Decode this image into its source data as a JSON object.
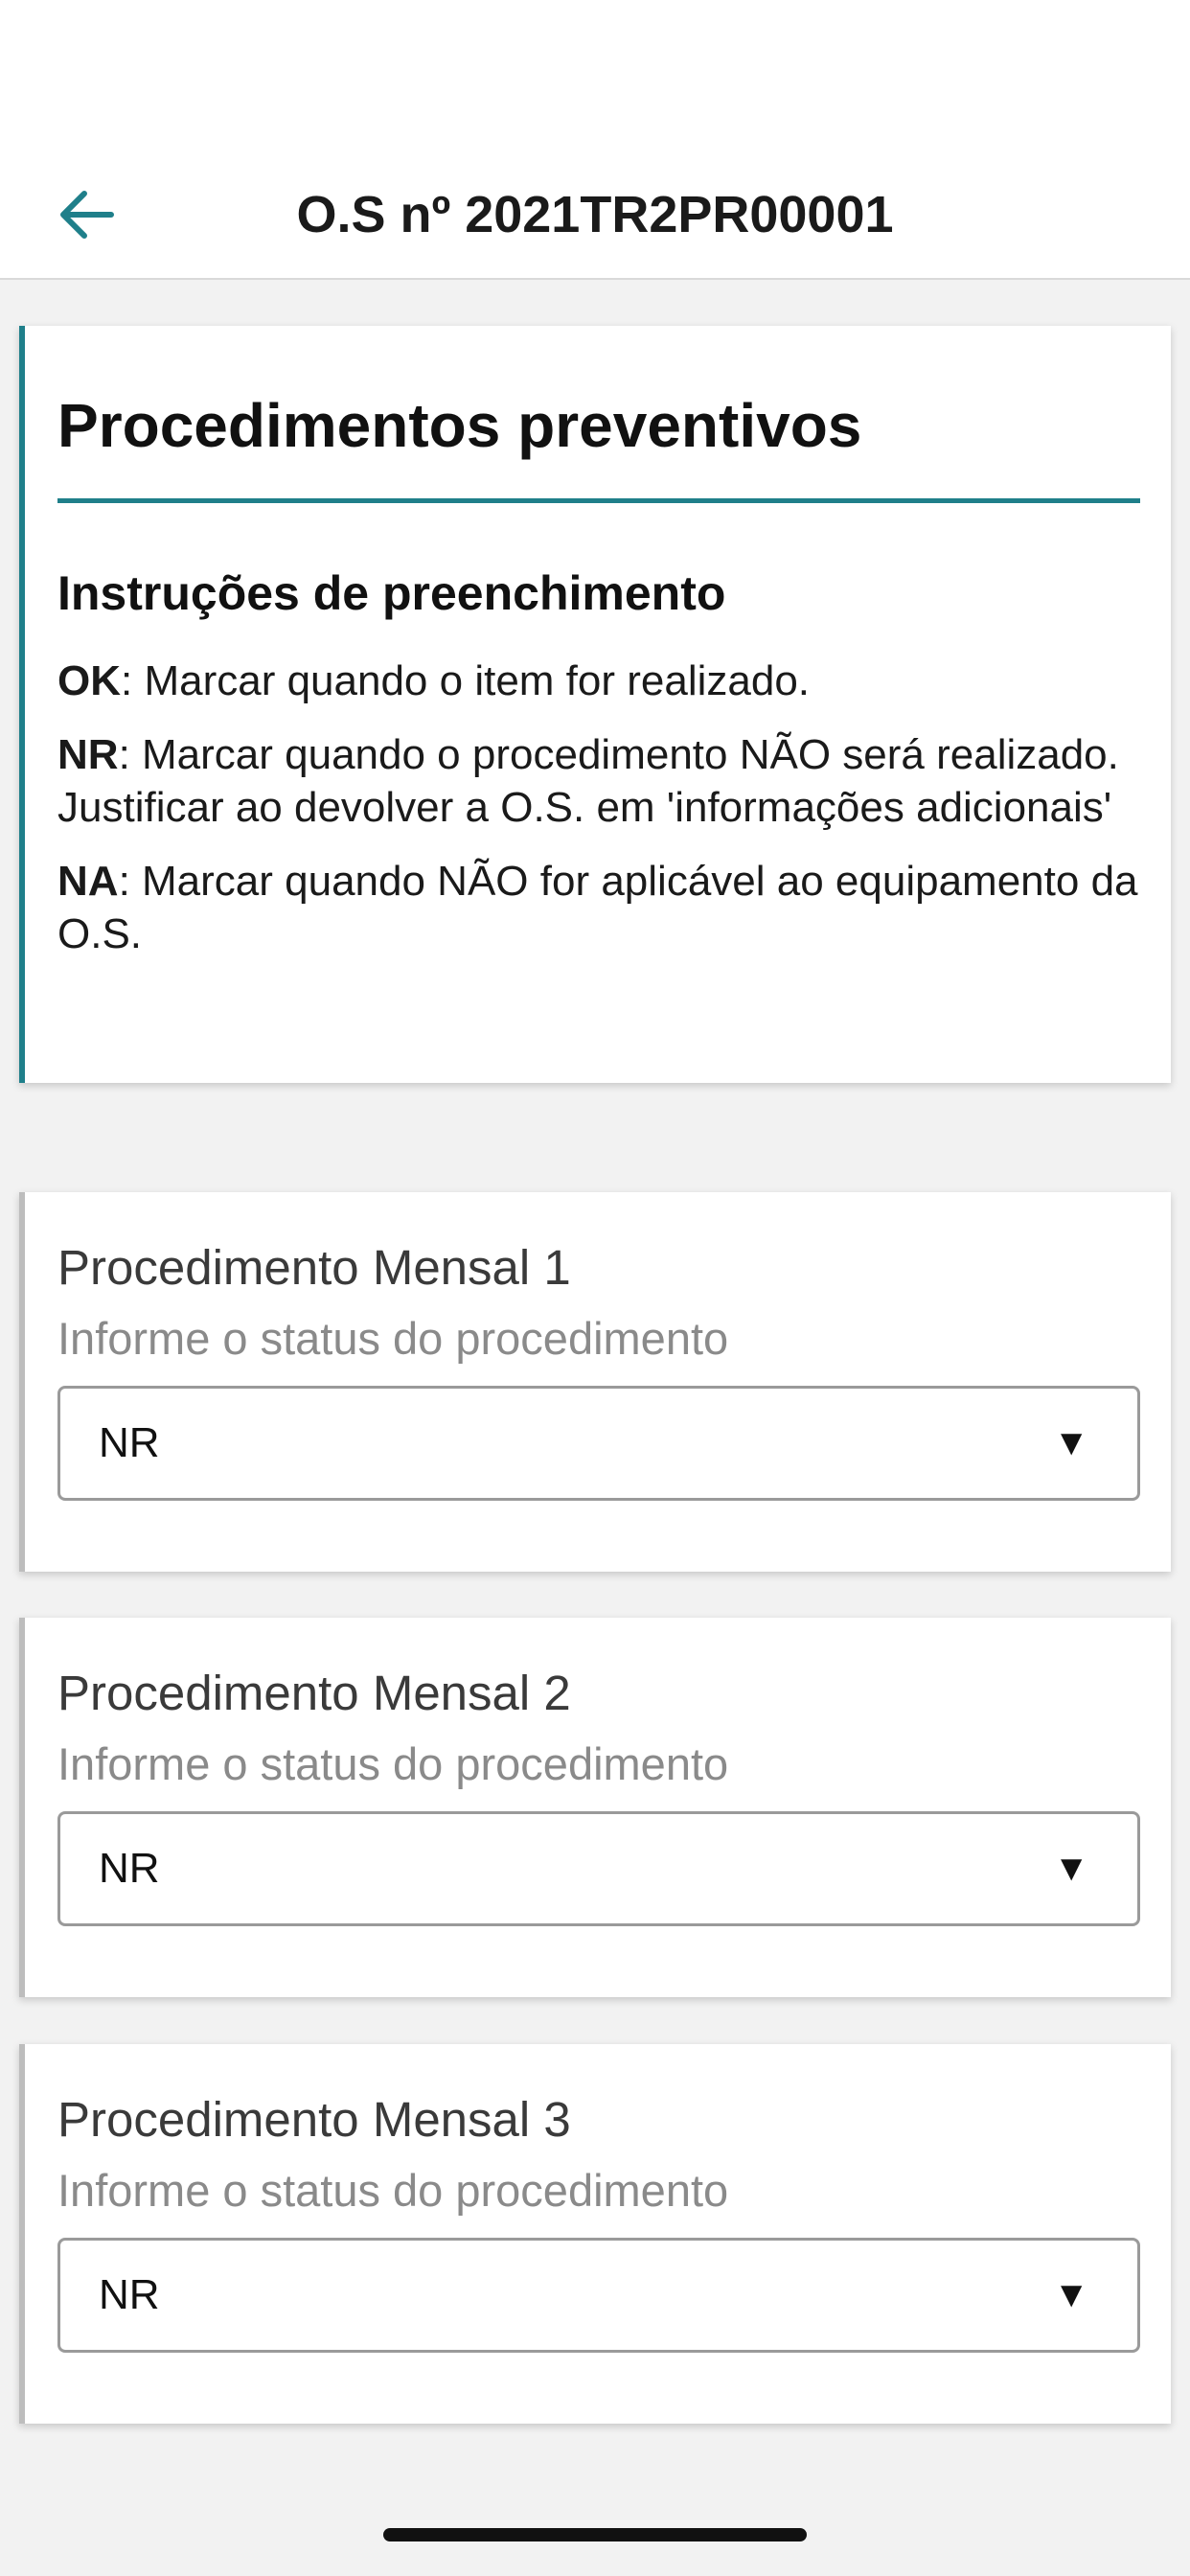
{
  "header": {
    "title": "O.S nº 2021TR2PR00001",
    "back_icon": "arrow-left-icon",
    "accent_color": "#1f7f8a"
  },
  "instructions": {
    "title": "Procedimentos preventivos",
    "subtitle": "Instruções de preenchimento",
    "items": [
      {
        "code": "OK",
        "text": ": Marcar quando o item for realizado."
      },
      {
        "code": "NR",
        "text": ": Marcar quando o procedimento NÃO será realizado. Justificar ao devolver a O.S. em 'informações adicionais'"
      },
      {
        "code": "NA",
        "text": ": Marcar quando NÃO for aplicável ao equipamento da O.S."
      }
    ]
  },
  "procedures": [
    {
      "title": "Procedimento Mensal 1",
      "hint": "Informe o status do procedimento",
      "value": "NR",
      "arrow": "▼"
    },
    {
      "title": "Procedimento Mensal 2",
      "hint": "Informe o status do procedimento",
      "value": "NR",
      "arrow": "▼"
    },
    {
      "title": "Procedimento Mensal 3",
      "hint": "Informe o status do procedimento",
      "value": "NR",
      "arrow": "▼"
    }
  ]
}
